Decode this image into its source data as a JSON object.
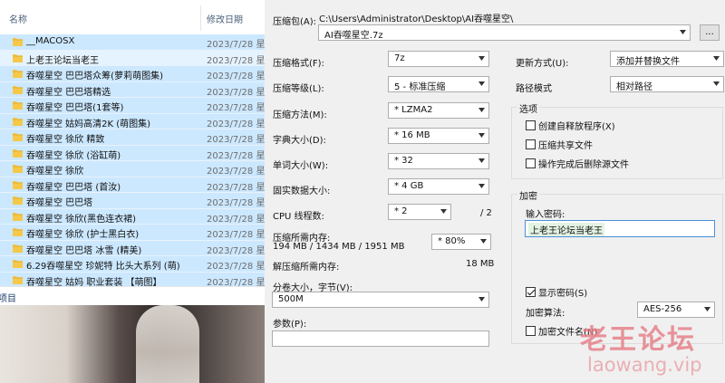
{
  "explorer": {
    "col_name": "名称",
    "col_date": "修改日期",
    "files": [
      {
        "name": "__MACOSX",
        "date": "2023/7/28 星"
      },
      {
        "name": "上老王论坛当老王",
        "date": "2023/7/28 星"
      },
      {
        "name": "吞噬星空  巴巴塔众筹(萝莉萌图集)",
        "date": "2023/7/28 星"
      },
      {
        "name": "吞噬星空  巴巴塔精选",
        "date": "2023/7/28 星"
      },
      {
        "name": "吞噬星空  巴巴塔(1套等)",
        "date": "2023/7/28 星"
      },
      {
        "name": "吞噬星空  姑妈高清2K (萌图集)",
        "date": "2023/7/28 星"
      },
      {
        "name": "吞噬星空  徐欣  精致",
        "date": "2023/7/28 星"
      },
      {
        "name": "吞噬星空  徐欣  (浴缸萌)",
        "date": "2023/7/28 星"
      },
      {
        "name": "吞噬星空  徐欣",
        "date": "2023/7/28 星"
      },
      {
        "name": "吞噬星空  巴巴塔 (首汝)",
        "date": "2023/7/28 星"
      },
      {
        "name": "吞噬星空  巴巴塔",
        "date": "2023/7/28 星"
      },
      {
        "name": "吞噬星空  徐欣(黑色连衣裙)",
        "date": "2023/7/28 星"
      },
      {
        "name": "吞噬星空  徐欣  (护士黑白衣)",
        "date": "2023/7/28 星"
      },
      {
        "name": "吞噬星空    巴巴塔 冰雪 (精美)",
        "date": "2023/7/28 星"
      },
      {
        "name": "6.29吞噬星空  珍妮特 比头大系列 (萌)",
        "date": "2023/7/28 星"
      },
      {
        "name": "吞噬星空  姑妈  职业套装 【萌图】",
        "date": "2023/7/28 星"
      }
    ],
    "status_text": "项目"
  },
  "dialog": {
    "archive_label": "压缩包(A):",
    "archive_path": "C:\\Users\\Administrator\\Desktop\\AI吞噬星空\\",
    "archive_name": "AI吞噬星空.7z",
    "browse_label": "...",
    "format_label": "压缩格式(F):",
    "format_value": "7z",
    "level_label": "压缩等级(L):",
    "level_value": "5 - 标准压缩",
    "method_label": "压缩方法(M):",
    "method_value": "* LZMA2",
    "dict_label": "字典大小(D):",
    "dict_value": "* 16 MB",
    "word_label": "单词大小(W):",
    "word_value": "* 32",
    "solid_label": "固实数据大小:",
    "solid_value": "* 4 GB",
    "cpu_label": "CPU 线程数:",
    "cpu_value": "* 2",
    "cpu_total": "/ 2",
    "mem_comp_label": "压缩所需内存:",
    "mem_comp_value": "194 MB / 1434 MB / 1951 MB",
    "mem_pct_value": "* 80%",
    "mem_decomp_label": "解压缩所需内存:",
    "mem_decomp_value": "18 MB",
    "split_label": "分卷大小，字节(V):",
    "split_value": "500M",
    "params_label": "参数(P):",
    "params_value": "",
    "update_label": "更新方式(U):",
    "update_value": "添加并替换文件",
    "path_label": "路径模式",
    "path_value": "相对路径",
    "options_title": "选项",
    "opt_sfx": "创建自释放程序(X)",
    "opt_shared": "压缩共享文件",
    "opt_delete": "操作完成后删除源文件",
    "encrypt_title": "加密",
    "pwd_label": "输入密码:",
    "pwd_value": "上老王论坛当老王",
    "show_pwd": "显示密码(S)",
    "enc_method_label": "加密算法:",
    "enc_method_value": "AES-256",
    "enc_names": "加密文件名(N)"
  },
  "watermark": {
    "cn": "老王论坛",
    "url": "laowang.vip"
  },
  "colors": {
    "selection": "#cce8ff",
    "folder": "#f5c84a",
    "dialog_bg": "#f0f0f0",
    "watermark": "#e57a84"
  }
}
